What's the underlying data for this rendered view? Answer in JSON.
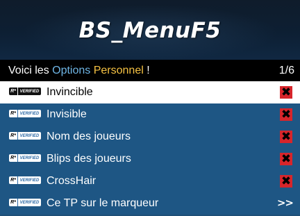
{
  "banner": {
    "title": "BS_MenuF5"
  },
  "subtitle": {
    "prefix": "Voici les ",
    "highlight1": "Options",
    "middle": " ",
    "highlight2": "Personnel",
    "suffix": " !",
    "page_counter": "1/6"
  },
  "badge": {
    "logo_text": "R*",
    "verified_text": "VERIFIED"
  },
  "items": [
    {
      "label": "Invincible",
      "state": "off",
      "selected": true
    },
    {
      "label": "Invisible",
      "state": "off",
      "selected": false
    },
    {
      "label": "Nom des joueurs",
      "state": "off",
      "selected": false
    },
    {
      "label": "Blips des joueurs",
      "state": "off",
      "selected": false
    },
    {
      "label": "CrossHair",
      "state": "off",
      "selected": false
    },
    {
      "label": "Ce TP sur le marqueur",
      "state": "submenu",
      "selected": false
    }
  ],
  "glyphs": {
    "off": "✖",
    "submenu": ">>"
  },
  "icons": {
    "off": "close-x-icon",
    "submenu": "double-chevron-right-icon"
  },
  "colors": {
    "accent_blue": "#6fb6e6",
    "accent_yellow": "#f5c243",
    "row_bg": "#1e5684",
    "off_box": "#d7252b",
    "selected_bg": "#ffffff"
  }
}
